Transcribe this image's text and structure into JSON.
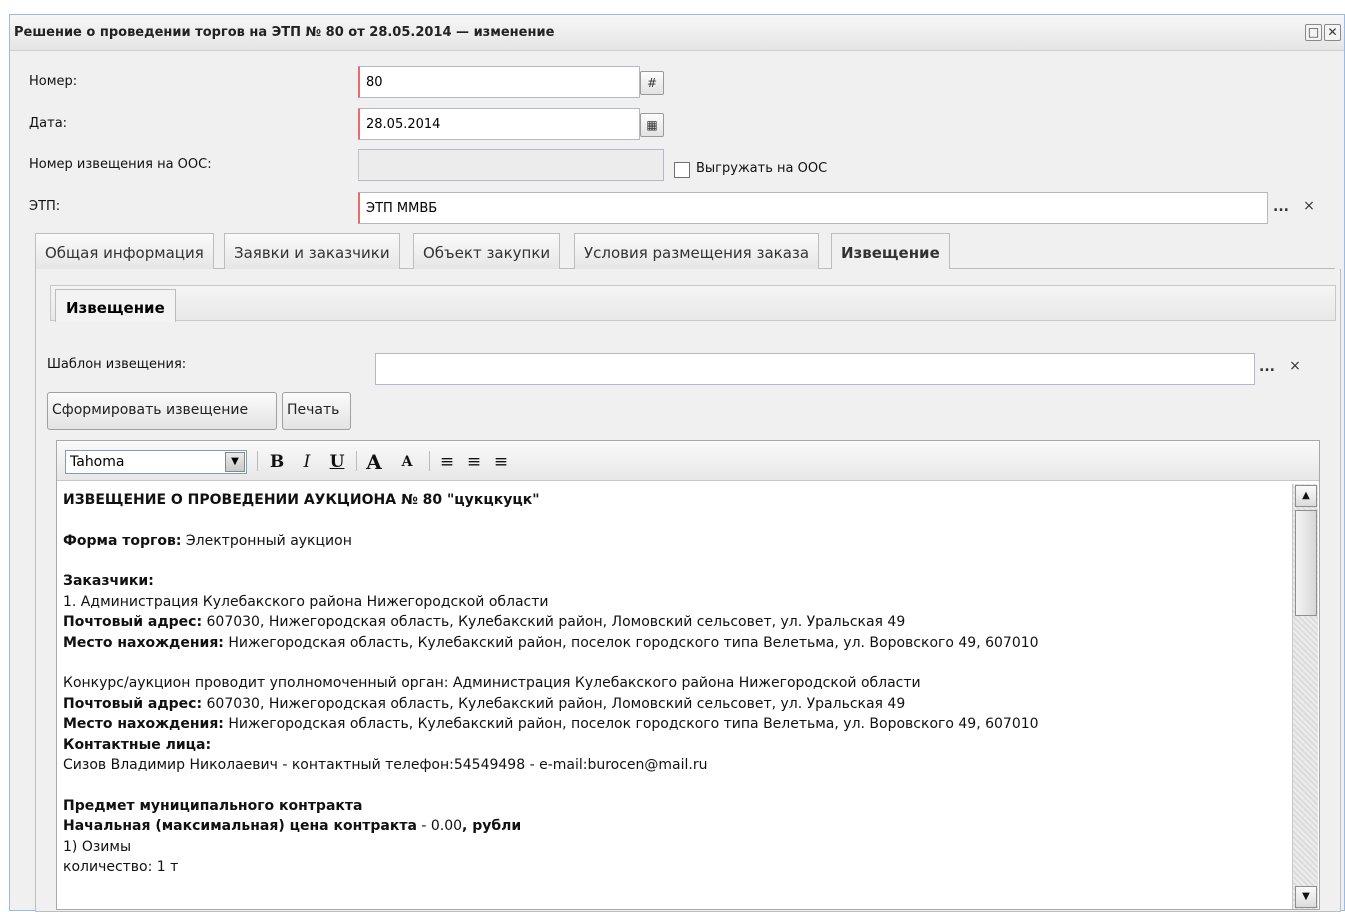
{
  "window": {
    "title": "Решение о проведении торгов на ЭТП № 80 от 28.05.2014 — изменение"
  },
  "form": {
    "number_label": "Номер:",
    "number_value": "80",
    "date_label": "Дата:",
    "date_value": "28.05.2014",
    "oos_notice_label": "Номер извещения на ООС:",
    "oos_notice_value": "",
    "export_oos_label": "Выгружать на ООС",
    "etp_label": "ЭТП:",
    "etp_value": "ЭТП ММВБ",
    "ellipsis": "...",
    "clear": "×"
  },
  "tabs": [
    {
      "label": "Общая информация"
    },
    {
      "label": "Заявки и заказчики"
    },
    {
      "label": "Объект закупки"
    },
    {
      "label": "Условия размещения заказа"
    },
    {
      "label": "Извещение"
    }
  ],
  "subtab": {
    "label": "Извещение"
  },
  "notice": {
    "template_label": "Шаблон извещения:",
    "template_value": "",
    "generate_button": "Сформировать извещение",
    "print_button": "Печать"
  },
  "editor": {
    "font": "Tahoma",
    "toolbar": {
      "bold": "B",
      "italic": "I",
      "underline": "U",
      "grow": "A",
      "shrink": "A"
    },
    "lines": {
      "l1": "ИЗВЕЩЕНИЕ О ПРОВЕДЕНИИ АУКЦИОНА № 80 \"цукцкуцк\"",
      "l2b": "Форма торгов:",
      "l2": " Электронный аукцион",
      "l3": "Заказчики:",
      "l4": "1. Администрация Кулебакского района Нижегородской области",
      "l5b": "Почтовый адрес:",
      "l5": " 607030, Нижегородская область, Кулебакский район, Ломовский сельсовет, ул. Уральская 49",
      "l6b": "Место нахождения:",
      "l6": " Нижегородская область, Кулебакский район, поселок городского типа Велетьма, ул. Воровского 49, 607010",
      "l7": "Конкурс/аукцион проводит уполномоченный орган: Администрация Кулебакского района Нижегородской области",
      "l8b": "Почтовый адрес:",
      "l8": " 607030, Нижегородская область, Кулебакский район, Ломовский сельсовет, ул. Уральская 49",
      "l9b": "Место нахождения:",
      "l9": " Нижегородская область, Кулебакский район, поселок городского типа Велетьма, ул. Воровского 49, 607010",
      "l10": "Контактные лица:",
      "l11": "Сизов Владимир Николаевич - контактный телефон:54549498 - e-mail:burocen@mail.ru",
      "l12": "Предмет муниципального контракта",
      "l13b": "Начальная (максимальная) цена контракта",
      "l13": " - 0.00",
      "l13c": ", рубли",
      "l14": "1) Озимы",
      "l15": "количество: 1 т"
    }
  }
}
